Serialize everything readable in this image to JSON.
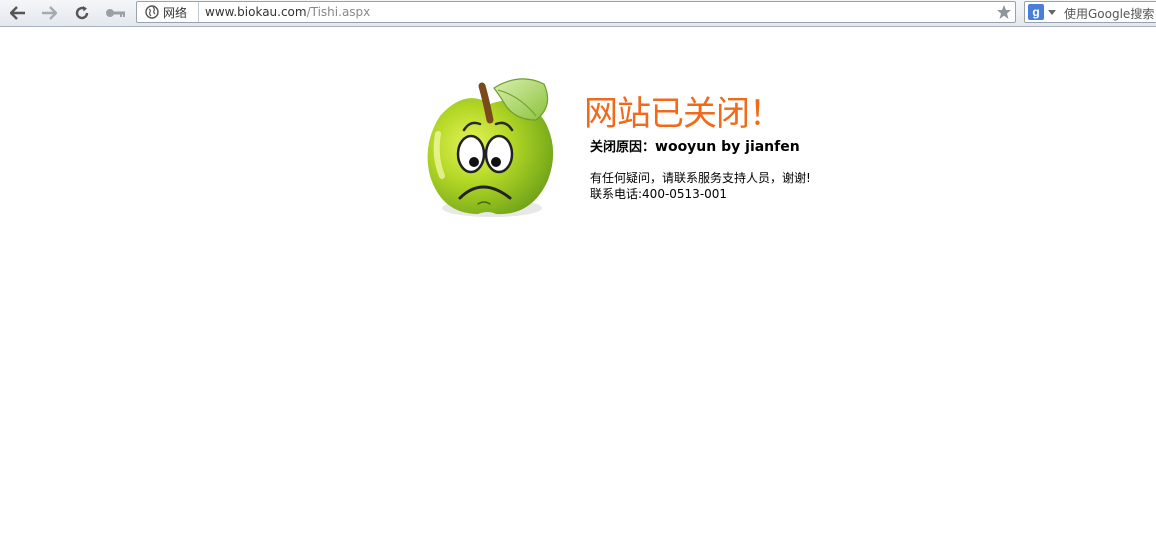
{
  "browser": {
    "site_label": "网络",
    "url_host": "www.biokau.com",
    "url_path": "/Tishi.aspx",
    "search_engine_badge": "g",
    "search_placeholder": "使用Google搜索",
    "icons": {
      "back": "arrow-left-icon",
      "forward": "arrow-right-icon",
      "reload": "reload-icon",
      "key": "key-icon",
      "globe": "globe-icon",
      "bookmark": "star-icon"
    }
  },
  "page": {
    "title": "网站已关闭！",
    "reason_label": "关闭原因：",
    "reason_value": "wooyun by jianfen",
    "notice_line1": "有任何疑问，请联系服务支持人员，谢谢!",
    "notice_line2": "联系电话:400-0513-001",
    "colors": {
      "title": "#f06a1c",
      "apple": "#9ccc1a"
    }
  }
}
